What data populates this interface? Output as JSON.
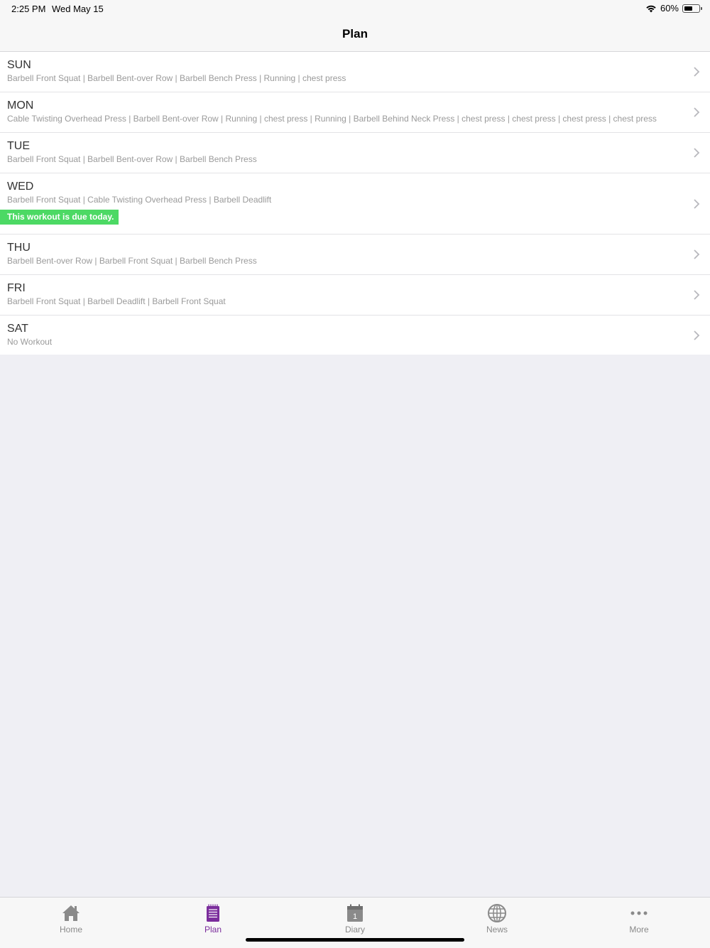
{
  "status_bar": {
    "time": "2:25 PM",
    "date": "Wed May 15",
    "battery": "60%",
    "battery_level": 0.6
  },
  "nav": {
    "title": "Plan"
  },
  "days": [
    {
      "day": "SUN",
      "exercises": "Barbell Front Squat | Barbell Bent-over Row | Barbell Bench Press | Running | chest press"
    },
    {
      "day": "MON",
      "exercises": "Cable Twisting Overhead Press | Barbell Bent-over Row | Running | chest press | Running | Barbell Behind Neck Press | chest press | chest press | chest press | chest press"
    },
    {
      "day": "TUE",
      "exercises": "Barbell Front Squat | Barbell Bent-over Row | Barbell Bench Press"
    },
    {
      "day": "WED",
      "exercises": "Barbell Front Squat | Cable Twisting Overhead Press | Barbell Deadlift",
      "badge": "This workout is due today."
    },
    {
      "day": "THU",
      "exercises": "Barbell Bent-over Row | Barbell Front Squat | Barbell Bench Press"
    },
    {
      "day": "FRI",
      "exercises": "Barbell Front Squat | Barbell Deadlift | Barbell Front Squat"
    },
    {
      "day": "SAT",
      "exercises": "No Workout"
    }
  ],
  "tabs": [
    {
      "label": "Home",
      "icon": "home-icon"
    },
    {
      "label": "Plan",
      "icon": "notepad-icon",
      "active": true
    },
    {
      "label": "Diary",
      "icon": "calendar-icon",
      "calendar_day": "1"
    },
    {
      "label": "News",
      "icon": "globe-icon"
    },
    {
      "label": "More",
      "icon": "more-icon"
    }
  ],
  "colors": {
    "accent": "#7b2d9c",
    "due_badge": "#4cd964",
    "background": "#efeff4"
  }
}
